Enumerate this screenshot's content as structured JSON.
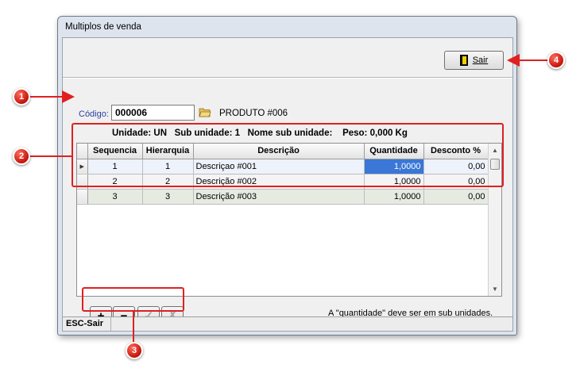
{
  "window": {
    "title": "Multiplos de venda"
  },
  "toolbar": {
    "sair_label": "Sair",
    "sair_icon": "exit-door-icon"
  },
  "form": {
    "codigo_label": "Código:",
    "codigo_value": "000006",
    "produto_name": "PRODUTO #006",
    "info_line": "Unidade: UN   Sub unidade: 1   Nome sub unidade:    Peso: 0,000 Kg"
  },
  "grid": {
    "columns": [
      "Sequencia",
      "Hierarquia",
      "Descrição",
      "Quantidade",
      "Desconto %"
    ],
    "rows": [
      {
        "sequencia": "1",
        "hierarquia": "1",
        "descricao": "Descriçao #001",
        "quantidade": "1,0000",
        "desconto": "0,00"
      },
      {
        "sequencia": "2",
        "hierarquia": "2",
        "descricao": "Descrição #002",
        "quantidade": "1,0000",
        "desconto": "0,00"
      },
      {
        "sequencia": "3",
        "hierarquia": "3",
        "descricao": "Descrição #003",
        "quantidade": "1,0000",
        "desconto": "0,00"
      }
    ],
    "row_indicator": "▶"
  },
  "buttons": {
    "add": "+",
    "remove": "−",
    "confirm": "✓",
    "cancel": "✗"
  },
  "hint": "A \"quantidade\" deve ser em sub unidades.",
  "status": {
    "text": "ESC-Sair"
  },
  "annotations": [
    "1",
    "2",
    "3",
    "4"
  ],
  "colors": {
    "annotation": "#e02020",
    "selection": "#3a77d6",
    "label_blue": "#2b3fa0"
  }
}
